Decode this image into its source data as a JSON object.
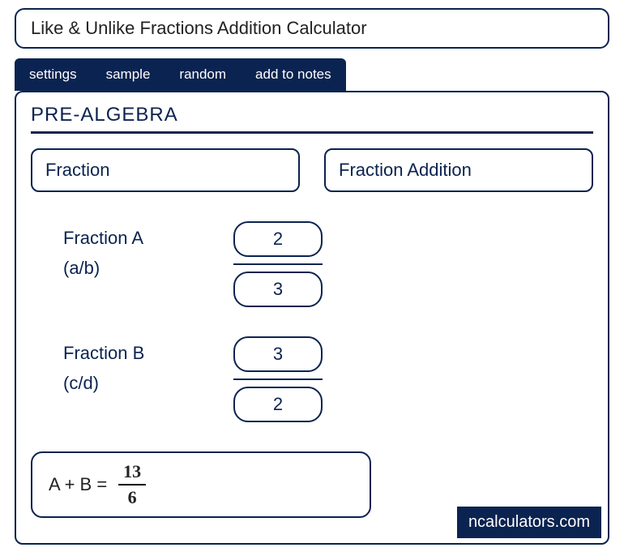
{
  "title": "Like & Unlike Fractions Addition Calculator",
  "tabs": [
    "settings",
    "sample",
    "random",
    "add to notes"
  ],
  "section": "PRE-ALGEBRA",
  "selector1": "Fraction",
  "selector2": "Fraction Addition",
  "fractionA": {
    "label": "Fraction A",
    "sub": "(a/b)",
    "numerator": "2",
    "denominator": "3"
  },
  "fractionB": {
    "label": "Fraction B",
    "sub": "(c/d)",
    "numerator": "3",
    "denominator": "2"
  },
  "result": {
    "lhs": "A + B  =",
    "numerator": "13",
    "denominator": "6"
  },
  "brand": "ncalculators.com"
}
